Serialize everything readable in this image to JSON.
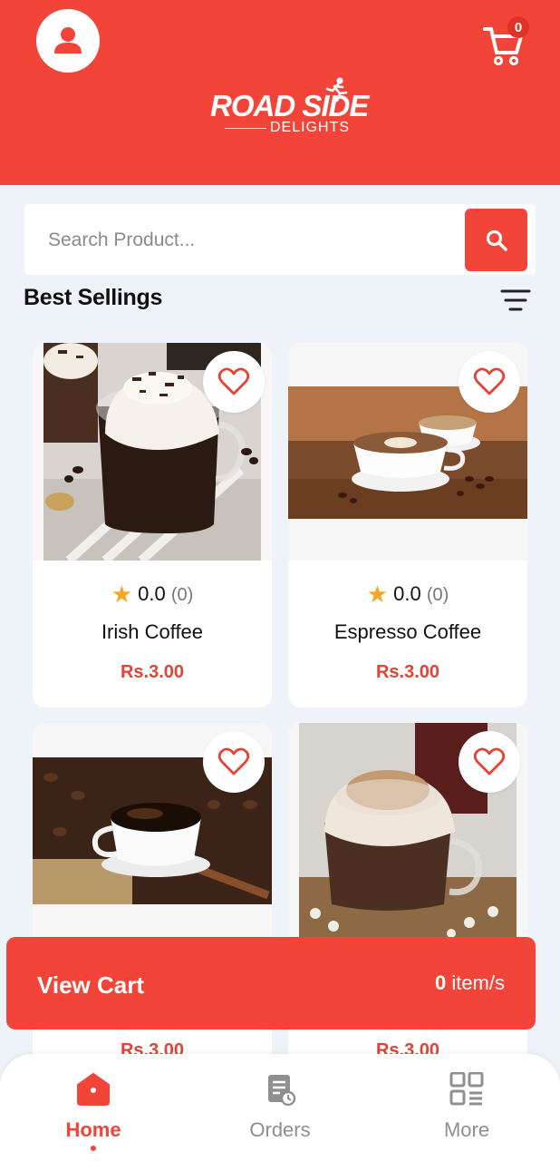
{
  "header": {
    "logo_main": "ROAD SIDE",
    "logo_sub": "DELIGHTS",
    "cart_count": "0"
  },
  "search": {
    "placeholder": "Search Product..."
  },
  "section": {
    "title": "Best Sellings"
  },
  "products": [
    {
      "name": "Irish Coffee",
      "rating": "0.0",
      "reviews": "(0)",
      "price": "Rs.3.00"
    },
    {
      "name": "Espresso Coffee",
      "rating": "0.0",
      "reviews": "(0)",
      "price": "Rs.3.00"
    },
    {
      "price": "Rs.3.00"
    },
    {
      "price": "Rs.3.00"
    }
  ],
  "view_cart": {
    "label": "View Cart",
    "count": "0",
    "suffix": "item/s"
  },
  "nav": {
    "items": [
      {
        "label": "Home",
        "icon": "home-icon",
        "active": true
      },
      {
        "label": "Orders",
        "icon": "orders-icon",
        "active": false
      },
      {
        "label": "More",
        "icon": "grid-icon",
        "active": false
      }
    ]
  },
  "colors": {
    "brand": "#f24438",
    "price": "#e24335",
    "star": "#f5a623",
    "background": "#eef3f9"
  }
}
